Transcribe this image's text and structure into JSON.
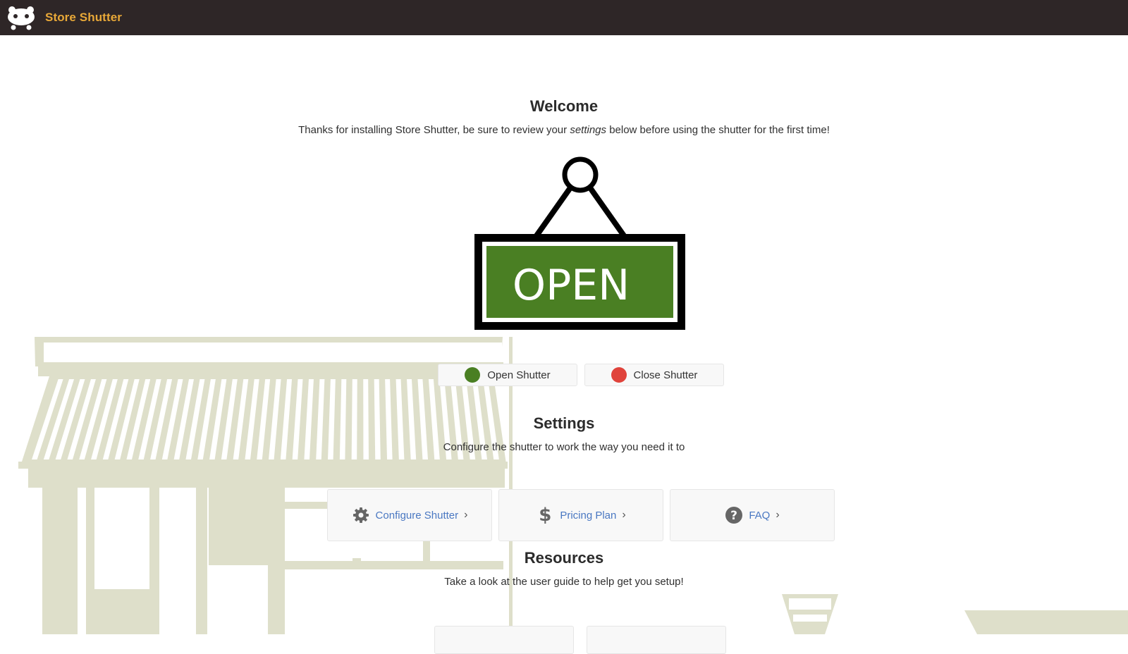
{
  "header": {
    "app_title": "Store Shutter",
    "logo_icon": "mascot-face-icon"
  },
  "welcome": {
    "title": "Welcome",
    "subtitle_before": "Thanks for installing Store Shutter, be sure to review your ",
    "subtitle_em": "settings",
    "subtitle_after": " below before using the shutter for the first time!",
    "sign_text": "OPEN",
    "sign_color": "#4a7f23"
  },
  "shutter_buttons": [
    {
      "label": "Open Shutter",
      "dot_color": "#4a7f23"
    },
    {
      "label": "Close Shutter",
      "dot_color": "#e0433b"
    }
  ],
  "settings": {
    "title": "Settings",
    "subtitle": "Configure the shutter to work the way you need it to",
    "cards": [
      {
        "label": "Configure Shutter",
        "icon": "gear-icon"
      },
      {
        "label": "Pricing Plan",
        "icon": "dollar-icon"
      },
      {
        "label": "FAQ",
        "icon": "question-circle-icon"
      }
    ]
  },
  "resources": {
    "title": "Resources",
    "subtitle": "Take a look at the user guide to help get you setup!"
  },
  "colors": {
    "header_bg": "#2e2627",
    "brand": "#e8a838",
    "link": "#4a78c2",
    "art": "#dedfca"
  }
}
